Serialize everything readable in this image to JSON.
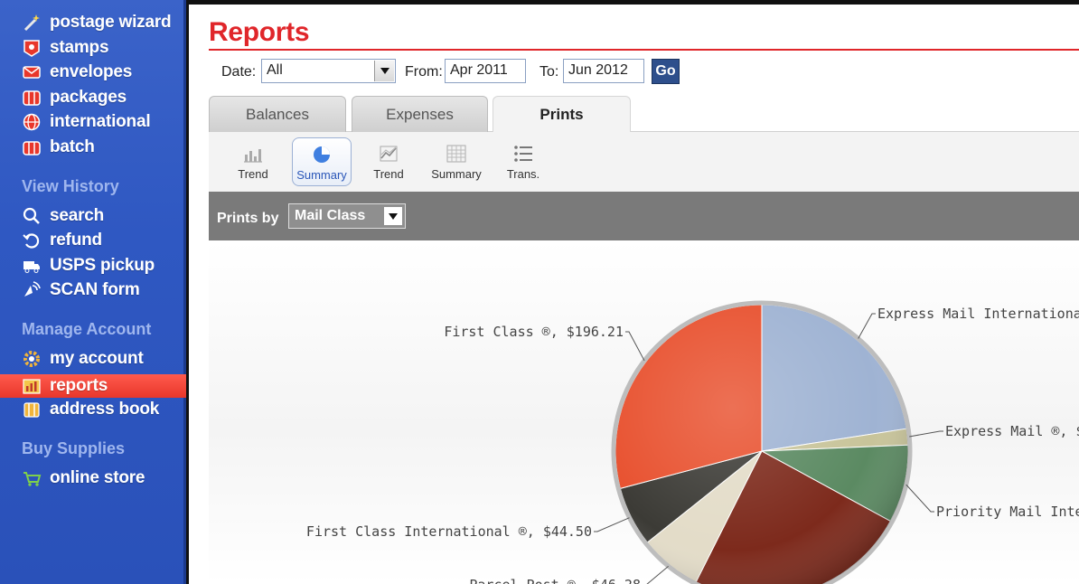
{
  "sidebar": {
    "items": [
      {
        "label": "postage wizard",
        "icon": "magic-wand-icon"
      },
      {
        "label": "stamps",
        "icon": "stamp-icon"
      },
      {
        "label": "envelopes",
        "icon": "envelope-icon"
      },
      {
        "label": "packages",
        "icon": "package-icon"
      },
      {
        "label": "international",
        "icon": "globe-icon"
      },
      {
        "label": "batch",
        "icon": "batch-icon"
      }
    ],
    "history_heading": "View History",
    "history_items": [
      {
        "label": "search",
        "icon": "search-icon"
      },
      {
        "label": "refund",
        "icon": "refund-icon"
      },
      {
        "label": "USPS pickup",
        "icon": "truck-icon"
      },
      {
        "label": "SCAN form",
        "icon": "scan-icon"
      }
    ],
    "account_heading": "Manage Account",
    "account_items": [
      {
        "label": "my account",
        "icon": "gear-icon"
      },
      {
        "label": "reports",
        "icon": "bar-chart-icon",
        "active": true
      },
      {
        "label": "address book",
        "icon": "address-book-icon"
      }
    ],
    "supplies_heading": "Buy Supplies",
    "supplies_items": [
      {
        "label": "online store",
        "icon": "cart-icon"
      }
    ],
    "active_color": "#e8372b"
  },
  "header": {
    "title": "Reports",
    "title_color": "#e0262a"
  },
  "filters": {
    "date_label": "Date:",
    "date_value": "All",
    "from_label": "From:",
    "from_value": "Apr 2011",
    "to_label": "To:",
    "to_value": "Jun 2012",
    "go_label": "Go"
  },
  "tabs": [
    {
      "label": "Balances",
      "active": false
    },
    {
      "label": "Expenses",
      "active": false
    },
    {
      "label": "Prints",
      "active": true
    }
  ],
  "subtoolbar": [
    {
      "label": "Trend",
      "icon": "bar-trend-icon",
      "selected": false
    },
    {
      "label": "Summary",
      "icon": "pie-icon",
      "selected": true
    },
    {
      "label": "Trend",
      "icon": "line-trend-icon",
      "selected": false
    },
    {
      "label": "Summary",
      "icon": "grid-icon",
      "selected": false
    },
    {
      "label": "Trans.",
      "icon": "list-icon",
      "selected": false
    }
  ],
  "report_bar": {
    "prints_by_label": "Prints by",
    "group_by_value": "Mail Class"
  },
  "chart_data": {
    "type": "pie",
    "title": "",
    "slices": [
      {
        "label": "Express Mail International",
        "value": 152.0,
        "color": "#9fb3d3"
      },
      {
        "label": "Express Mail ®, $",
        "value": 12.0,
        "color": "#c8c49a"
      },
      {
        "label": "Priority Mail Interna",
        "value": 58.0,
        "color": "#5b8a62"
      },
      {
        "label": "",
        "value": 165.0,
        "color": "#7d2a1c"
      },
      {
        "label": "Parcel Post ®, $46.28",
        "value": 46.28,
        "color": "#e3dcc8"
      },
      {
        "label": "First Class International ®, $44.50",
        "value": 44.5,
        "color": "#3c3b36"
      },
      {
        "label": "First Class ®, $196.21",
        "value": 196.21,
        "color": "#e8512f"
      }
    ]
  }
}
